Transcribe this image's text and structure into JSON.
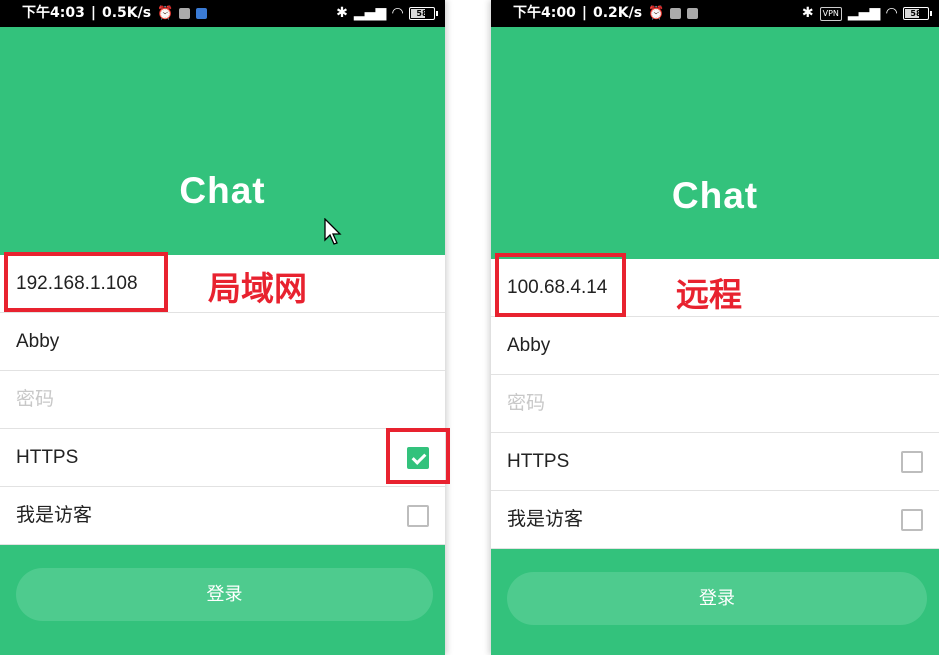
{
  "left_screen": {
    "status": {
      "time": "下午4:03",
      "speed": "0.5K/s",
      "battery": "58"
    },
    "title": "Chat",
    "fields": {
      "server": "192.168.1.108",
      "username": "Abby",
      "password_placeholder": "密码",
      "https_label": "HTTPS",
      "guest_label": "我是访客"
    },
    "https_checked": true,
    "guest_checked": false,
    "login_label": "登录",
    "annotation": "局域网"
  },
  "right_screen": {
    "status": {
      "time": "下午4:00",
      "speed": "0.2K/s",
      "battery": "58",
      "vpn": "VPN"
    },
    "title": "Chat",
    "fields": {
      "server": "100.68.4.14",
      "username": "Abby",
      "password_placeholder": "密码",
      "https_label": "HTTPS",
      "guest_label": "我是访客"
    },
    "https_checked": false,
    "guest_checked": false,
    "login_label": "登录",
    "annotation": "远程"
  },
  "colors": {
    "brand_green": "#33c27c",
    "button_green": "#4ecb8e",
    "highlight_red": "#e8222f"
  }
}
